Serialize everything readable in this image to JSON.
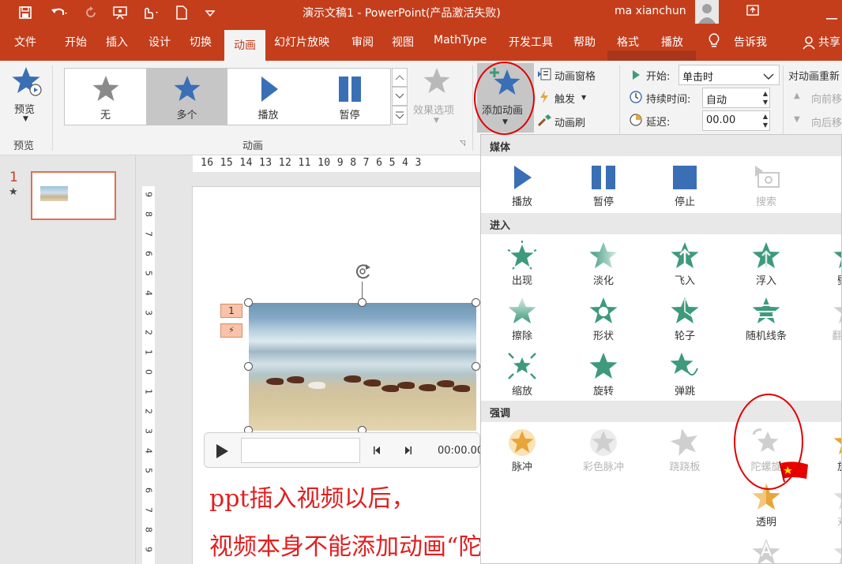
{
  "titlebar": {
    "title": "演示文稿1  -  PowerPoint(产品激活失败)",
    "user": "ma xianchun"
  },
  "tabs": [
    "文件",
    "开始",
    "插入",
    "设计",
    "切换",
    "动画",
    "幻灯片放映",
    "审阅",
    "视图",
    "MathType",
    "开发工具",
    "帮助",
    "格式",
    "播放",
    "告诉我",
    "共享"
  ],
  "ribbon": {
    "preview_label": "预览",
    "preview_group": "预览",
    "gallery": [
      "无",
      "多个",
      "播放",
      "暂停"
    ],
    "effect_options": "效果选项",
    "animation_group": "动画",
    "add_animation": "添加动画",
    "animation_pane": "动画窗格",
    "trigger": "触发",
    "painter": "动画刷",
    "start_label": "开始:",
    "start_value": "单击时",
    "duration_label": "持续时间:",
    "duration_value": "自动",
    "delay_label": "延迟:",
    "delay_value": "00.00",
    "reorder_title": "对动画重新",
    "move_earlier": "向前移",
    "move_later": "向后移"
  },
  "slides": {
    "number": "1"
  },
  "ruler": {
    "h": "16 15 14 13 12 11 10 9 8 7 6 5 4 3",
    "v": [
      "9",
      "8",
      "7",
      "6",
      "5",
      "4",
      "3",
      "2",
      "1",
      "0",
      "1",
      "2",
      "3",
      "4",
      "5",
      "6",
      "7",
      "8",
      "9"
    ]
  },
  "slide": {
    "tags": [
      "1",
      "⚡"
    ],
    "player_time": "00:00.00"
  },
  "caption": {
    "line1": "ppt插入视频以后，",
    "line2": "视频本身不能添加动画“陀螺旋”"
  },
  "dropdown": {
    "media_header": "媒体",
    "media": [
      "播放",
      "暂停",
      "停止",
      "搜索"
    ],
    "enter_header": "进入",
    "enter": [
      "出现",
      "淡化",
      "飞入",
      "浮入",
      "劈裂",
      "擦除",
      "形状",
      "轮子",
      "随机线条",
      "翻转式",
      "缩放",
      "旋转",
      "弹跳"
    ],
    "emphasis_header": "强调",
    "emphasis": [
      "脉冲",
      "彩色脉冲",
      "跷跷板",
      "陀螺旋",
      "放大",
      "透明",
      "对象"
    ]
  },
  "colors": {
    "accent": "#c43e1c",
    "enter_star": "#3e9a7a",
    "media_blue": "#3a6fb5",
    "emphasis_gold": "#e7a53a",
    "annotation_red": "#e01f1f"
  }
}
